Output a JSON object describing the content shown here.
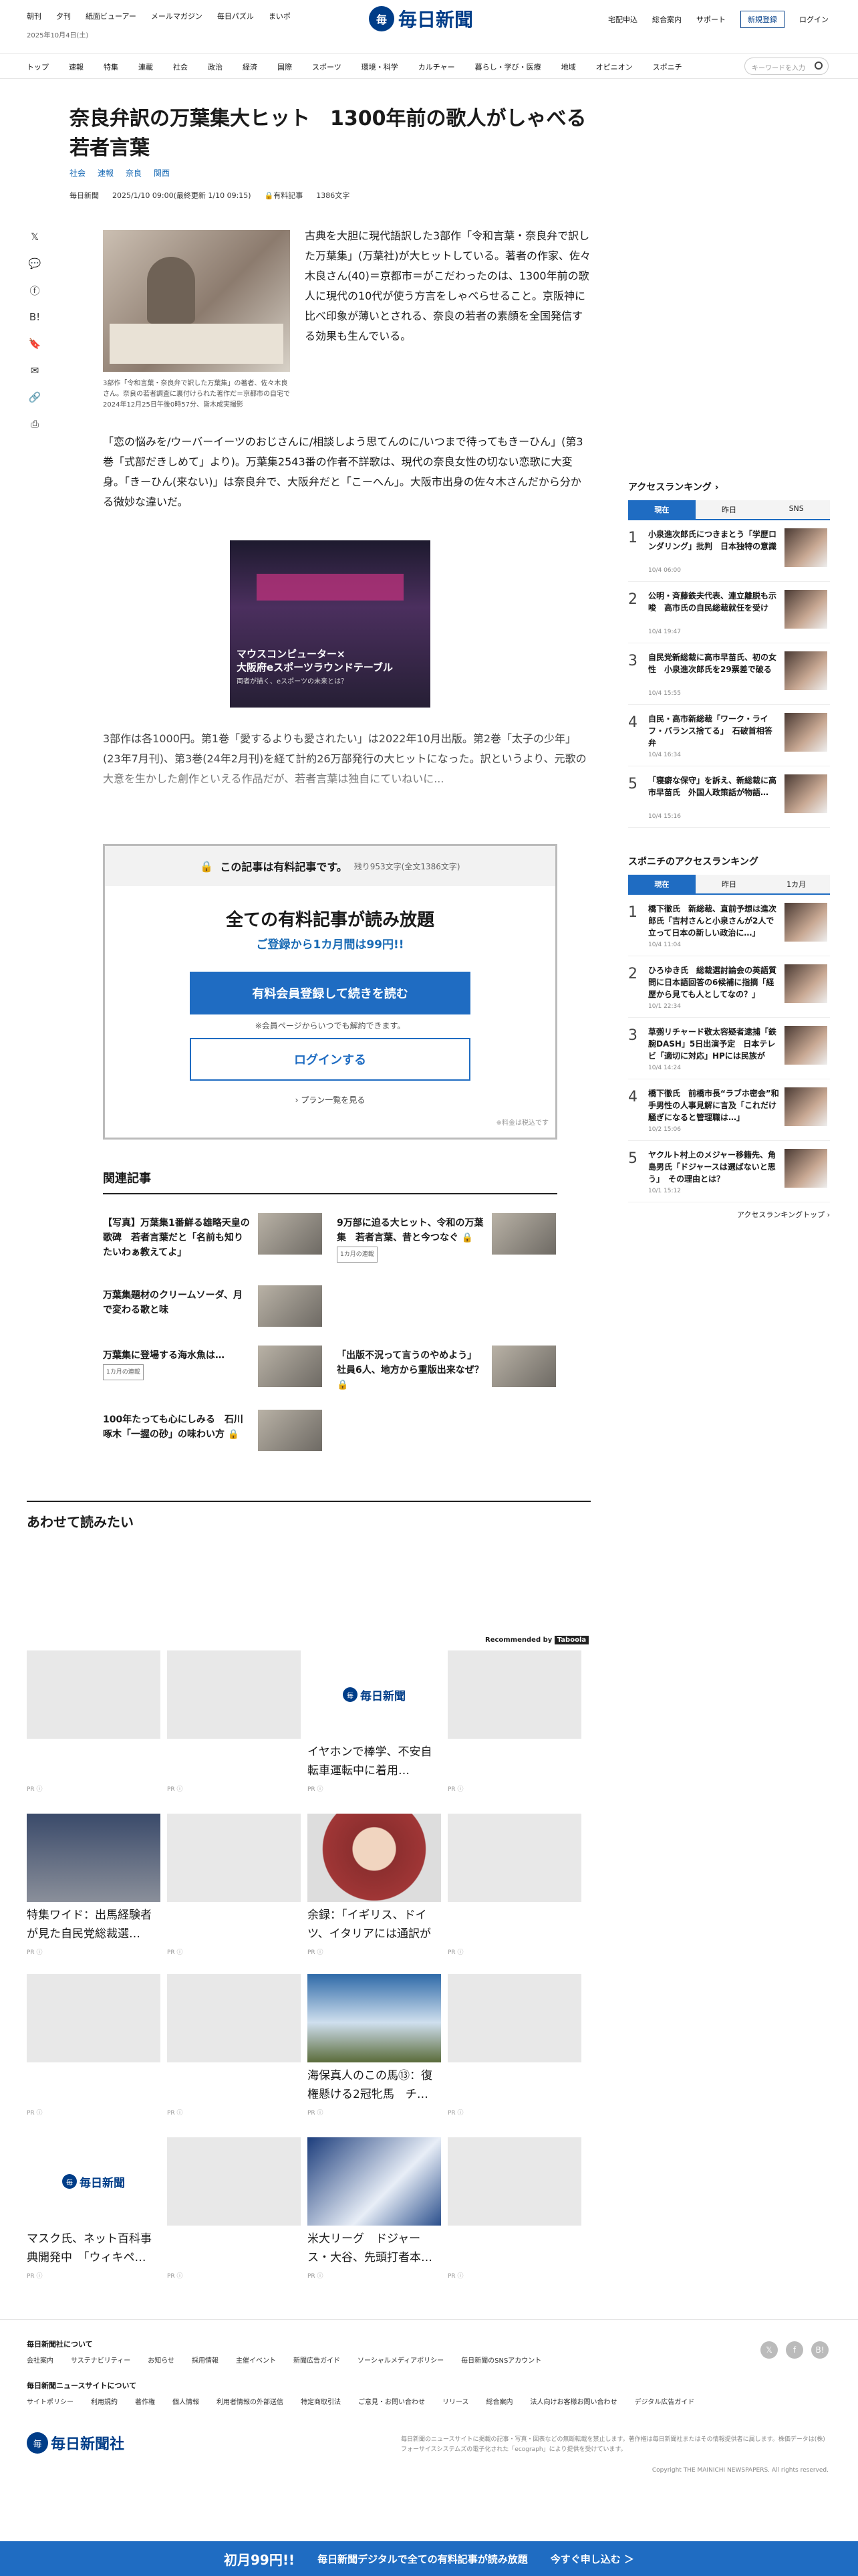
{
  "top": {
    "links": [
      "朝刊",
      "夕刊",
      "紙面ビューアー",
      "メールマガジン",
      "毎日パズル",
      "まいポ"
    ],
    "date": "2025年10月4日(土)",
    "right": [
      "宅配申込",
      "総合案内",
      "サポート"
    ],
    "register": "新規登録",
    "login": "ログイン"
  },
  "logo": {
    "mark": "毎",
    "name": "毎日新聞"
  },
  "nav": {
    "items": [
      "トップ",
      "速報",
      "特集",
      "連載",
      "社会",
      "政治",
      "経済",
      "国際",
      "スポーツ",
      "環境・科学",
      "カルチャー",
      "暮らし・学び・医療",
      "地域",
      "オピニオン",
      "スポニチ"
    ],
    "search_placeholder": "キーワードを入力"
  },
  "article": {
    "title": "奈良弁訳の万葉集大ヒット　1300年前の歌人がしゃべる若者言葉",
    "tags": [
      "社会",
      "速報",
      "奈良",
      "関西"
    ],
    "source": "毎日新聞",
    "datetime": "2025/1/10 09:00(最終更新 1/10 09:15)",
    "paid": "有料記事",
    "chars": "1386文字",
    "caption": "3部作「令和言葉・奈良弁で訳した万葉集」の著者、佐々木良さん。奈良の若者調査に裏付けられた著作だ＝京都市の自宅で2024年12月25日午後0時57分、皆木成実撮影",
    "lead": "古典を大胆に現代語訳した3部作「令和言葉・奈良弁で訳した万葉集」(万葉社)が大ヒットしている。著者の作家、佐々木良さん(40)＝京都市＝がこだわったのは、1300年前の歌人に現代の10代が使う方言をしゃべらせること。京阪神に比べ印象が薄いとされる、奈良の若者の素顔を全国発信する効果も生んでいる。",
    "p2": "「恋の悩みを/ウーバーイーツのおじさんに/相談しよう思てんのに/いつまで待ってもきーひん」(第3巻「式部だきしめて」より)。万葉集2543番の作者不詳歌は、現代の奈良女性の切ない恋歌に大変身。「きーひん(来ない)」は奈良弁で、大阪弁だと「こーへん」。大阪市出身の佐々木さんだから分かる微妙な違いだ。",
    "p3": "3部作は各1000円。第1巻「愛するよりも愛されたい」は2022年10月出版。第2巻「太子の少年」(23年7月刊)、第3巻(24年2月刊)を経て計約26万部発行の大ヒットになった。訳というより、元歌の大意を生かした創作といえる作品だが、若者言葉は独自にていねいに..."
  },
  "ad": {
    "title": "マウスコンピューター×\n大阪府eスポーツラウンドテーブル",
    "sub": "両者が描く、eスポーツの未来とは？"
  },
  "paywall": {
    "head": "この記事は有料記事です。",
    "remain": "残り953文字(全文1386文字)",
    "big": "全ての有料記事が読み放題",
    "sub": "ご登録から1カ月間は99円!!",
    "cta": "有料会員登録して続きを読む",
    "note": "※会員ページからいつでも解約できます。",
    "login": "ログインする",
    "plans": "プラン一覧を見る",
    "tax": "※料金は税込です"
  },
  "related": {
    "heading": "関連記事",
    "items": [
      {
        "t": "【写真】万葉集1番鮮る雄略天皇の歌碑　若者言葉だと「名前も知りたいわぁ教えてよ」",
        "b": ""
      },
      {
        "t": "9万部に迫る大ヒット、令和の万葉集　若者言葉、昔と今つなぐ",
        "b": "1カ月の連載"
      },
      {
        "t": "万葉集題材のクリームソーダ、月で変わる歌と味",
        "b": ""
      },
      {
        "t": "「出版不況って言うのやめよう」社員6人、地方から重版出来なぜ？",
        "b": ""
      },
      {
        "t": "万葉集に登場する海水魚は…",
        "b": "1カ月の連載"
      },
      {
        "t": "100年たっても心にしみる　石川啄木「一握の砂」の味わい方",
        "b": ""
      }
    ]
  },
  "awase": "あわせて読みたい",
  "recommended": "Recommended by",
  "taboola": "Taboola",
  "cards": [
    {
      "t": "",
      "img": "gray"
    },
    {
      "t": "",
      "img": "gray"
    },
    {
      "t": "イヤホンで棒学、不安自転車運転中に着用…",
      "img": "logo"
    },
    {
      "t": "",
      "img": "gray"
    },
    {
      "t": "特集ワイド：出馬経験者が見た自民党総裁選…",
      "img": "ph1"
    },
    {
      "t": "",
      "img": "gray"
    },
    {
      "t": "余録：「イギリス、ドイツ、イタリアには通訳がつ…",
      "img": "ph2"
    },
    {
      "t": "",
      "img": "gray"
    },
    {
      "t": "",
      "img": "gray"
    },
    {
      "t": "",
      "img": "gray"
    },
    {
      "t": "海保真人のこの馬⑬：復権懸ける2冠牝馬　チ…",
      "img": "ph3"
    },
    {
      "t": "",
      "img": "gray"
    },
    {
      "t": "マスク氏、ネット百科事典開発中　「ウィキペ…",
      "img": "logo"
    },
    {
      "t": "",
      "img": "gray"
    },
    {
      "t": "米大リーグ　ドジャース・大谷、先頭打者本…",
      "img": "ph4"
    },
    {
      "t": "",
      "img": "gray"
    }
  ],
  "pr": "PR ⓘ",
  "access": {
    "heading": "アクセスランキング",
    "tabs": [
      "現在",
      "昨日",
      "SNS"
    ],
    "items": [
      {
        "t": "小泉進次郎氏につきまとう「学歴ロンダリング」批判　日本独特の意識",
        "tm": "10/4 06:00"
      },
      {
        "t": "公明・斉藤鉄夫代表、連立離脱も示唆　高市氏の自民総裁就任を受け",
        "tm": "10/4 19:47"
      },
      {
        "t": "自民党新総裁に高市早苗氏、初の女性　小泉進次郎氏を29票差で破る",
        "tm": "10/4 15:55"
      },
      {
        "t": "自民・高市新総裁「ワーク・ライフ・バランス捨てる」　石破首相答弁",
        "tm": "10/4 16:34"
      },
      {
        "t": "「寝癖な保守」を訴え、新総裁に高市早苗氏　外国人政策話が物語…",
        "tm": "10/4 15:16"
      }
    ]
  },
  "sponichi": {
    "heading": "スポニチのアクセスランキング",
    "tabs": [
      "現在",
      "昨日",
      "1カ月"
    ],
    "items": [
      {
        "t": "橋下徹氏　新総裁、直前予想は進次郎氏「吉村さんと小泉さんが2人で立って日本の新しい政治に…」",
        "tm": "10/4 11:04"
      },
      {
        "t": "ひろゆき氏　総裁選討論会の英語質問に日本語回答の6候補に指摘「経歴から見ても人としてなの？」",
        "tm": "10/1 22:34"
      },
      {
        "t": "草彅リチャード敬太容疑者逮捕「鉄腕DASH」5日出演予定　日本テレビ「適切に対応」HPには民族が",
        "tm": "10/4 14:24"
      },
      {
        "t": "橋下徹氏　前橋市長“ラブホ密会”和手男性の人事見解に言及「これだけ騒ぎになると管理職は…」",
        "tm": "10/2 15:06"
      },
      {
        "t": "ヤクルト村上のメジャー移籍先、角島男氏「ドジャースは選ばないと思う」　その理由とは？",
        "tm": "10/1 15:12"
      }
    ],
    "more": "アクセスランキングトップ"
  },
  "footer": {
    "about": "毎日新聞社について",
    "links1": [
      "会社案内",
      "サステナビリティー",
      "お知らせ",
      "採用情報",
      "主催イベント",
      "新聞広告ガイド",
      "ソーシャルメディアポリシー",
      "毎日新聞のSNSアカウント"
    ],
    "site": "毎日新聞ニュースサイトについて",
    "links2": [
      "サイトポリシー",
      "利用規約",
      "著作権",
      "個人情報",
      "利用者情報の外部送信",
      "特定商取引法",
      "ご意見・お問い合わせ",
      "リリース",
      "総合案内",
      "法人向けお客様お問い合わせ",
      "デジタル広告ガイド"
    ],
    "logo": "毎日新聞社",
    "legal": "毎日新聞のニュースサイトに掲載の記事・写真・図表などの無断転載を禁止します。著作権は毎日新聞社またはその情報提供者に属します。株価データは(株)フォーサイスシステムズの電子化された「ecograph」により提供を受けています。",
    "copyright": "Copyright THE MAINICHI NEWSPAPERS. All rights reserved."
  },
  "bottom": {
    "a": "初月99円!!",
    "b": "毎日新聞デジタルで全ての有料記事が読み放題",
    "c": "今すぐ申し込む ＞"
  }
}
